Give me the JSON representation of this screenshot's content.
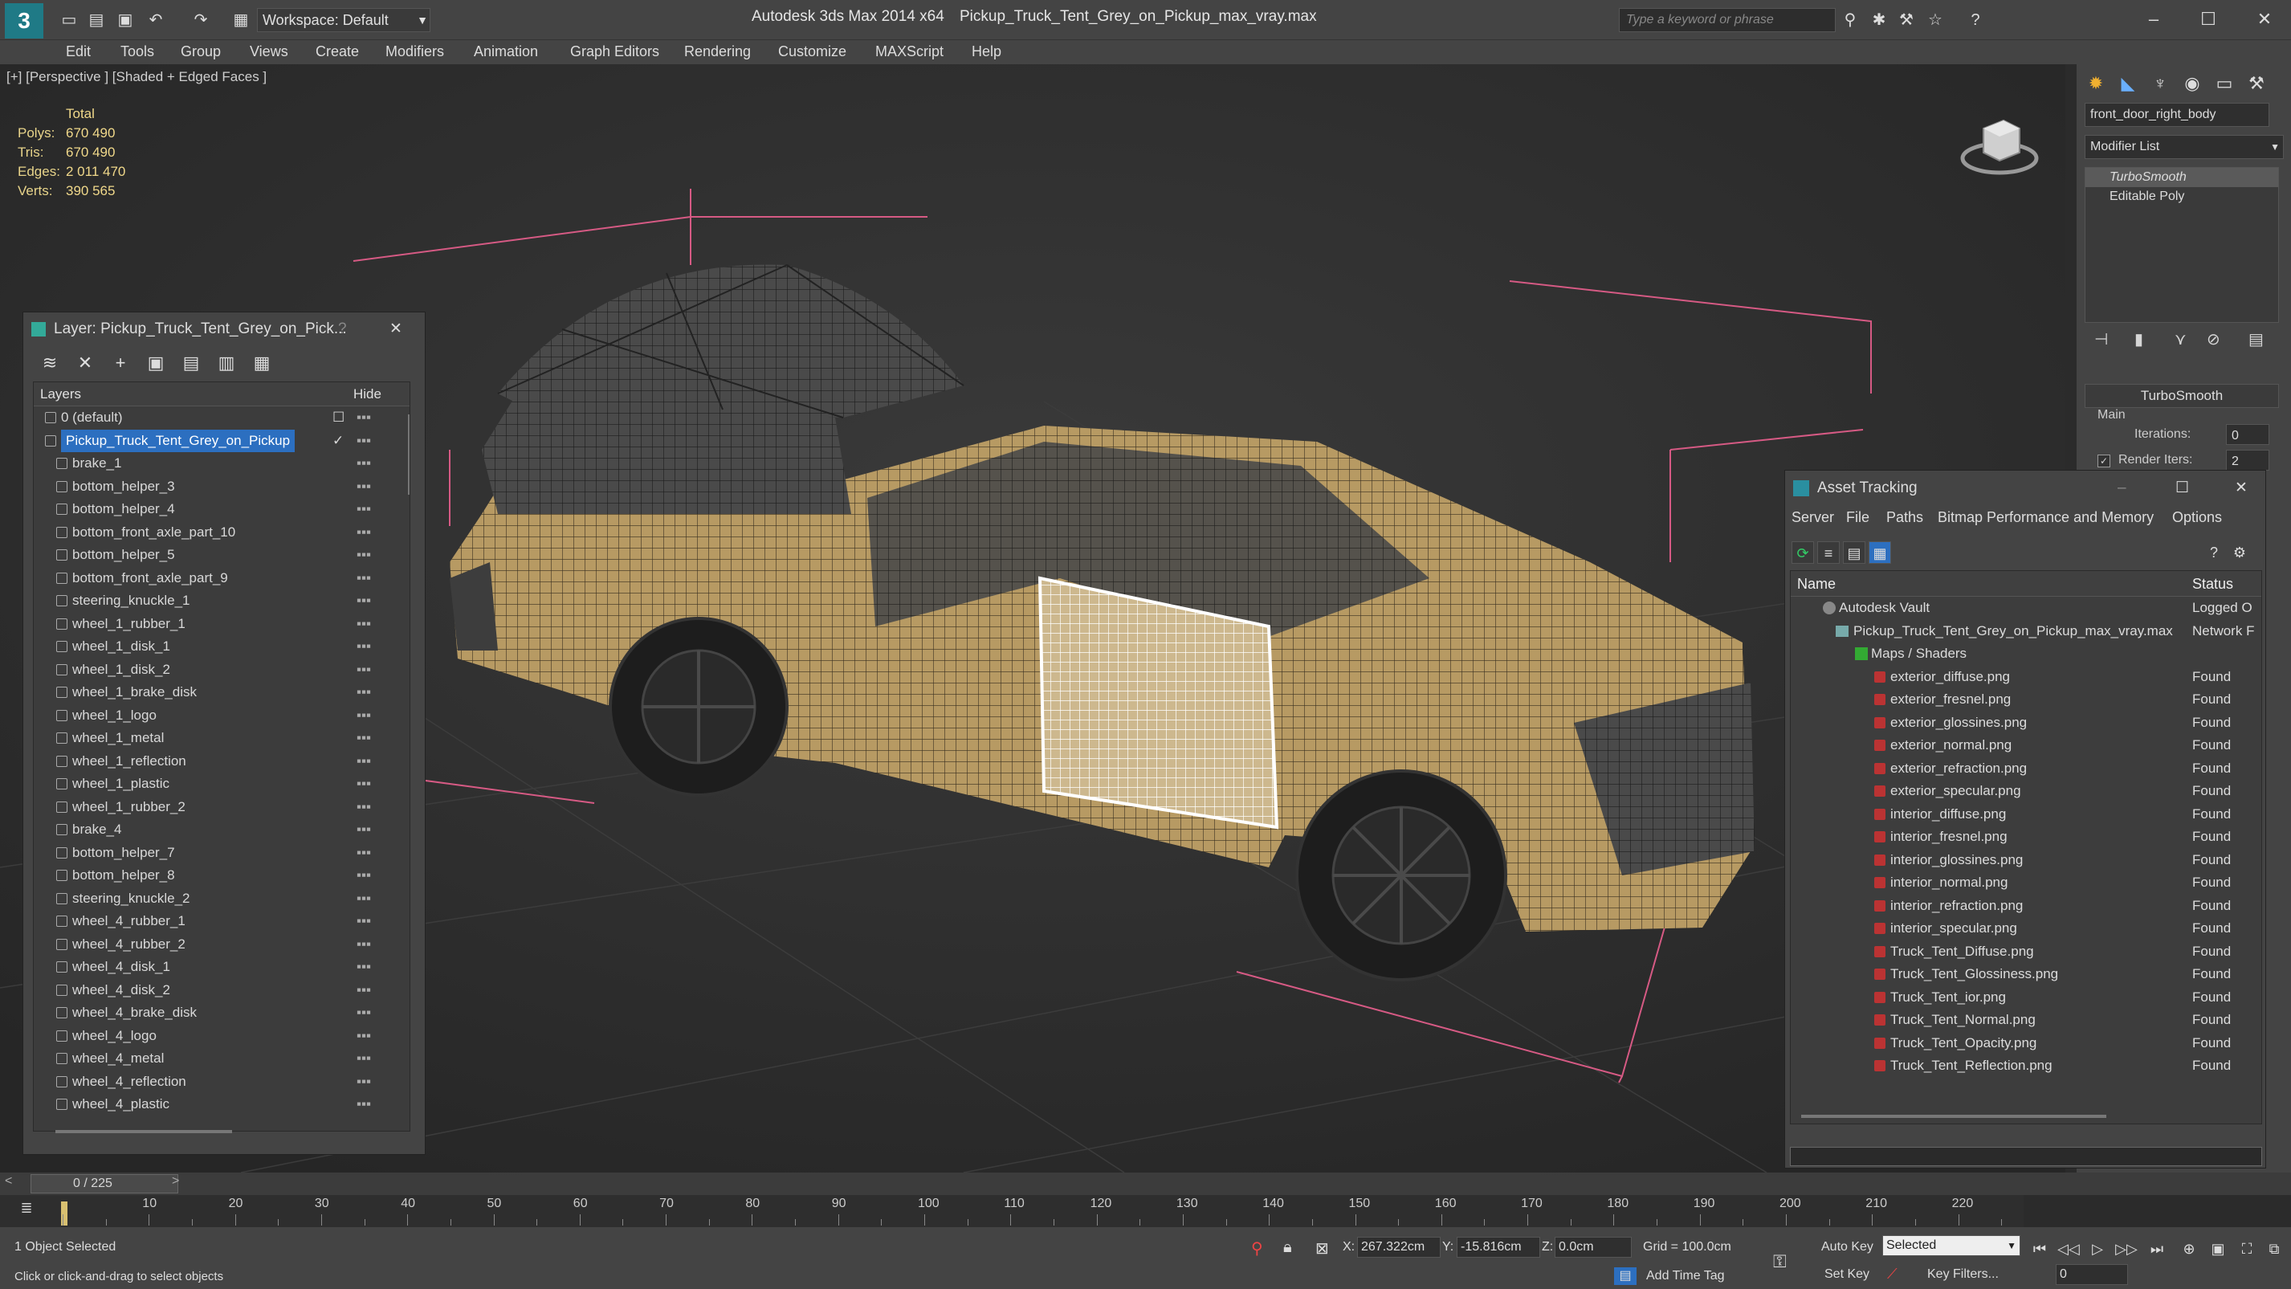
{
  "titlebar": {
    "workspace": "Workspace: Default",
    "app_title": "Autodesk 3ds Max  2014 x64",
    "file_title": "Pickup_Truck_Tent_Grey_on_Pickup_max_vray.max",
    "search_placeholder": "Type a keyword or phrase"
  },
  "menu": [
    "Edit",
    "Tools",
    "Group",
    "Views",
    "Create",
    "Modifiers",
    "Animation",
    "Graph Editors",
    "Rendering",
    "Customize",
    "MAXScript",
    "Help"
  ],
  "viewport": {
    "label": "[+] [Perspective ] [Shaded + Edged Faces ]",
    "stats_header": "Total",
    "stats": [
      {
        "label": "Polys:",
        "value": "670 490"
      },
      {
        "label": "Tris:",
        "value": "670 490"
      },
      {
        "label": "Edges:",
        "value": "2 011 470"
      },
      {
        "label": "Verts:",
        "value": "390 565"
      }
    ]
  },
  "layer_panel": {
    "title": "Layer: Pickup_Truck_Tent_Grey_on_Pick...",
    "help": "?",
    "col_layers": "Layers",
    "col_hide": "Hide",
    "rows": [
      "0 (default)",
      "Pickup_Truck_Tent_Grey_on_Pickup",
      "brake_1",
      "bottom_helper_3",
      "bottom_helper_4",
      "bottom_front_axle_part_10",
      "bottom_helper_5",
      "bottom_front_axle_part_9",
      "steering_knuckle_1",
      "wheel_1_rubber_1",
      "wheel_1_disk_1",
      "wheel_1_disk_2",
      "wheel_1_brake_disk",
      "wheel_1_logo",
      "wheel_1_metal",
      "wheel_1_reflection",
      "wheel_1_plastic",
      "wheel_1_rubber_2",
      "brake_4",
      "bottom_helper_7",
      "bottom_helper_8",
      "steering_knuckle_2",
      "wheel_4_rubber_1",
      "wheel_4_rubber_2",
      "wheel_4_disk_1",
      "wheel_4_disk_2",
      "wheel_4_brake_disk",
      "wheel_4_logo",
      "wheel_4_metal",
      "wheel_4_reflection",
      "wheel_4_plastic"
    ]
  },
  "command_panel": {
    "object_name": "front_door_right_body",
    "modifier_list": "Modifier List",
    "stack": [
      "TurboSmooth",
      "Editable Poly"
    ],
    "rollout_title": "TurboSmooth",
    "main_label": "Main",
    "iterations_label": "Iterations:",
    "iterations_value": "0",
    "render_iters_label": "Render Iters:",
    "render_iters_value": "2"
  },
  "asset_tracking": {
    "title": "Asset Tracking",
    "menus": [
      "Server",
      "File",
      "Paths",
      "Bitmap Performance and Memory",
      "Options"
    ],
    "col_name": "Name",
    "col_status": "Status",
    "vault": {
      "name": "Autodesk Vault",
      "status": "Logged O"
    },
    "file": {
      "name": "Pickup_Truck_Tent_Grey_on_Pickup_max_vray.max",
      "status": "Network F"
    },
    "group": "Maps / Shaders",
    "maps": [
      {
        "name": "exterior_diffuse.png",
        "status": "Found"
      },
      {
        "name": "exterior_fresnel.png",
        "status": "Found"
      },
      {
        "name": "exterior_glossines.png",
        "status": "Found"
      },
      {
        "name": "exterior_normal.png",
        "status": "Found"
      },
      {
        "name": "exterior_refraction.png",
        "status": "Found"
      },
      {
        "name": "exterior_specular.png",
        "status": "Found"
      },
      {
        "name": "interior_diffuse.png",
        "status": "Found"
      },
      {
        "name": "interior_fresnel.png",
        "status": "Found"
      },
      {
        "name": "interior_glossines.png",
        "status": "Found"
      },
      {
        "name": "interior_normal.png",
        "status": "Found"
      },
      {
        "name": "interior_refraction.png",
        "status": "Found"
      },
      {
        "name": "interior_specular.png",
        "status": "Found"
      },
      {
        "name": "Truck_Tent_Diffuse.png",
        "status": "Found"
      },
      {
        "name": "Truck_Tent_Glossiness.png",
        "status": "Found"
      },
      {
        "name": "Truck_Tent_ior.png",
        "status": "Found"
      },
      {
        "name": "Truck_Tent_Normal.png",
        "status": "Found"
      },
      {
        "name": "Truck_Tent_Opacity.png",
        "status": "Found"
      },
      {
        "name": "Truck_Tent_Reflection.png",
        "status": "Found"
      }
    ]
  },
  "timeline": {
    "frame_counter": "0 / 225",
    "ticks": [
      "10",
      "20",
      "30",
      "40",
      "50",
      "60",
      "70",
      "80",
      "90",
      "100",
      "110",
      "120",
      "130",
      "140",
      "150",
      "160",
      "170",
      "180",
      "190",
      "200",
      "210",
      "220"
    ]
  },
  "status": {
    "selected": "1 Object Selected",
    "prompt": "Click or click-and-drag to select objects",
    "x_label": "X:",
    "x_value": "267.322cm",
    "y_label": "Y:",
    "y_value": "-15.816cm",
    "z_label": "Z:",
    "z_value": "0.0cm",
    "grid": "Grid = 100.0cm",
    "add_time_tag": "Add Time Tag",
    "auto_key": "Auto Key",
    "set_key": "Set Key",
    "selected_dropdown": "Selected",
    "key_filters": "Key Filters...",
    "frame_value": "0"
  }
}
